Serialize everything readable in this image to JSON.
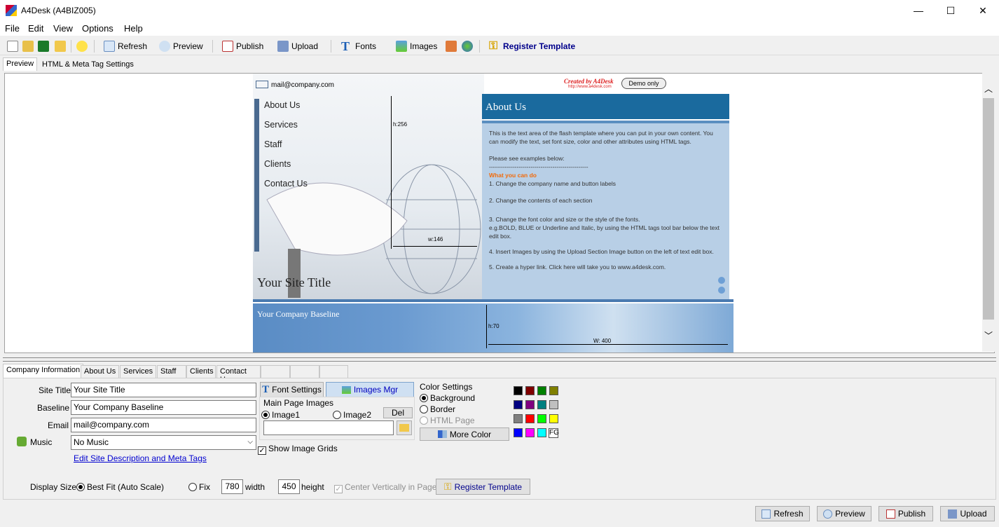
{
  "window": {
    "title": "A4Desk (A4BIZ005)",
    "minimize": "—",
    "maximize": "☐",
    "close": "✕"
  },
  "menu": [
    "File",
    "Edit",
    "View",
    "Options",
    "Help"
  ],
  "toolbar": {
    "refresh": "Refresh",
    "preview": "Preview",
    "publish": "Publish",
    "upload": "Upload",
    "fonts": "Fonts",
    "images": "Images",
    "register": "Register Template"
  },
  "top_tabs": [
    "Preview",
    "HTML & Meta Tag Settings"
  ],
  "site": {
    "email": "mail@company.com",
    "created_by": "Created by A4Desk",
    "created_url": "http://www.a4desk.com",
    "demo": "Demo only",
    "nav": [
      "About Us",
      "Services",
      "Staff",
      "Clients",
      "Contact Us"
    ],
    "h256": "h:256",
    "w146": "w:146",
    "about_title": "About Us",
    "body_p1": "This is the text area of the flash template where you can put in your own content.  You can modify the text, set font size, color and other attributes using HTML tags.",
    "body_p2": "Please see examples below:",
    "rule": "--------------------------------------------------",
    "what_you_can_do": "What you can do",
    "item1": "1. Change the company name and button labels",
    "item2": "2. Change the contents of each section",
    "item3": "3. Change the font color and size or the style of the fonts.",
    "item3b": "e.g.BOLD, BLUE  or Underline and Italic, by using the HTML tags tool bar below the text edit box.",
    "item4": "4. Insert Images by using the Upload Section Image button on the left of text edit box.",
    "item5": "5. Create a hyper link. Click here will take you to www.a4desk.com.",
    "site_title": "Your Site Title",
    "baseline": "Your Company Baseline",
    "h70": "h:70",
    "w400": "W: 400"
  },
  "bottom_tabs": [
    "Company Information",
    "About Us",
    "Services",
    "Staff",
    "Clients",
    "Contact Us",
    "",
    "",
    ""
  ],
  "form": {
    "site_title_label": "Site Title",
    "site_title_value": "Your Site Title",
    "baseline_label": "Baseline",
    "baseline_value": "Your Company Baseline",
    "email_label": "Email",
    "email_value": "mail@company.com",
    "music_label": "Music",
    "music_value": "No Music",
    "meta_link": "Edit Site Description and Meta Tags",
    "font_settings": "Font Settings",
    "images_mgr": "Images Mgr",
    "main_page_images": "Main Page Images",
    "image1": "Image1",
    "image2": "Image2",
    "del": "Del",
    "show_grids": "Show Image Grids",
    "color_settings": "Color Settings",
    "background": "Background",
    "border": "Border",
    "html_page": "HTML Page",
    "more_color": "More Color",
    "fg": "FG",
    "display_size": "Display Size",
    "best_fit": "Best Fit (Auto Scale)",
    "fix": "Fix",
    "width_value": "780",
    "width_label": "width",
    "height_value": "450",
    "height_label": "height",
    "center_vert": "Center Vertically in Page",
    "register": "Register Template"
  },
  "swatches": [
    "#000000",
    "#800000",
    "#008000",
    "#808000",
    "#000080",
    "#800080",
    "#008080",
    "#c0c0c0",
    "#808080",
    "#ff0000",
    "#00ff00",
    "#ffff00",
    "#0000ff",
    "#ff00ff",
    "#00ffff"
  ],
  "bottom_buttons": {
    "refresh": "Refresh",
    "preview": "Preview",
    "publish": "Publish",
    "upload": "Upload"
  }
}
